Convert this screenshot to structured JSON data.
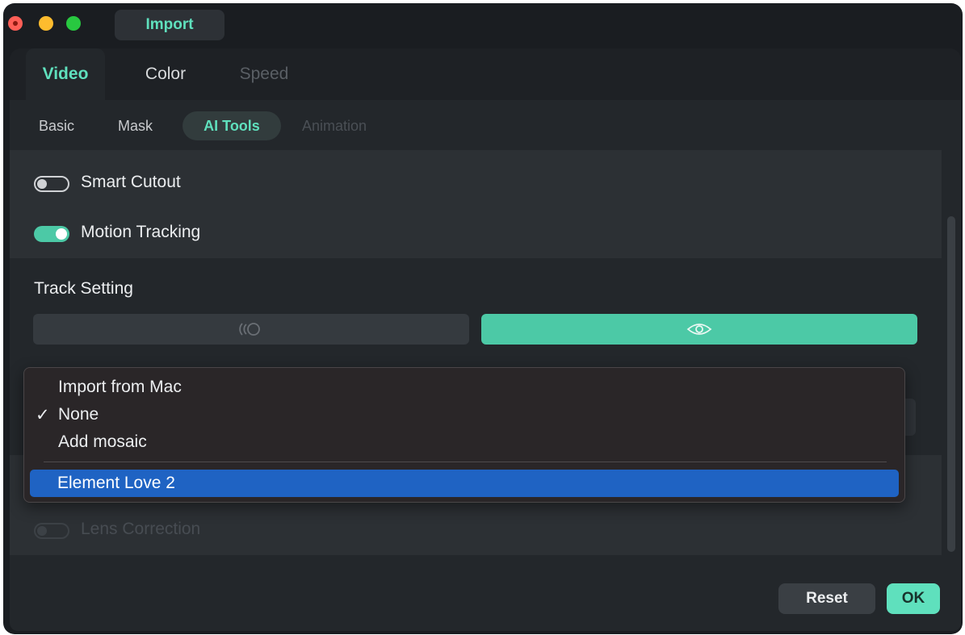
{
  "titlebar": {
    "import_label": "Import"
  },
  "tabs": [
    {
      "label": "Video",
      "state": "active"
    },
    {
      "label": "Color",
      "state": "normal"
    },
    {
      "label": "Speed",
      "state": "disabled"
    }
  ],
  "subtabs": [
    {
      "label": "Basic",
      "state": "normal"
    },
    {
      "label": "Mask",
      "state": "normal"
    },
    {
      "label": "AI Tools",
      "state": "active"
    },
    {
      "label": "Animation",
      "state": "disabled"
    }
  ],
  "toggles": {
    "smart_cutout": {
      "label": "Smart Cutout",
      "on": false
    },
    "motion_tracking": {
      "label": "Motion Tracking",
      "on": true
    },
    "lens_correction": {
      "label": "Lens Correction",
      "on": false,
      "disabled": true
    }
  },
  "track_setting": {
    "heading": "Track Setting",
    "buttons": [
      {
        "icon": "track-targets-icon",
        "selected": false
      },
      {
        "icon": "eye-icon",
        "selected": true
      }
    ]
  },
  "dropdown_menu": {
    "items": [
      {
        "label": "Import from Mac",
        "checked": false
      },
      {
        "label": "None",
        "checked": true,
        "check_mark": "✓"
      },
      {
        "label": "Add mosaic",
        "checked": false
      }
    ],
    "highlighted_item": {
      "label": "Element Love 2"
    }
  },
  "footer": {
    "reset_label": "Reset",
    "ok_label": "OK"
  },
  "colors": {
    "accent": "#5fe0bd",
    "selection": "#1f63c3",
    "window_bg": "#1a1d21",
    "panel_bg": "#23272b"
  }
}
